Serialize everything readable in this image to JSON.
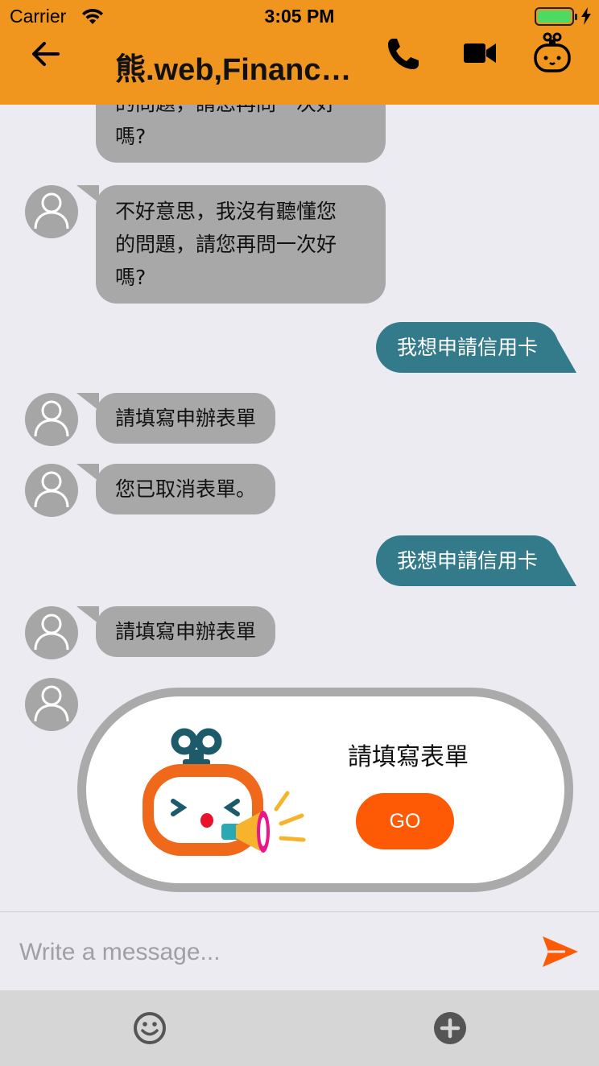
{
  "status_bar": {
    "carrier": "Carrier",
    "time": "3:05 PM"
  },
  "header": {
    "title": "熊.web,Finance...",
    "icons": [
      "back-arrow-icon",
      "phone-icon",
      "video-camera-icon",
      "robot-icon"
    ]
  },
  "messages": [
    {
      "from": "bot",
      "text": "的問題，請您再問一次好嗎?"
    },
    {
      "from": "bot",
      "lines": [
        "不好意思，我沒有聽懂您",
        "的問題，請您再問一次好",
        "嗎?"
      ]
    },
    {
      "from": "user",
      "text": "我想申請信用卡"
    },
    {
      "from": "bot",
      "text": "請填寫申辦表單"
    },
    {
      "from": "bot",
      "text": "您已取消表單。"
    },
    {
      "from": "user",
      "text": "我想申請信用卡"
    },
    {
      "from": "bot",
      "text": "請填寫申辦表單"
    }
  ],
  "form_card": {
    "title": "請填寫表單",
    "button_label": "GO"
  },
  "composer": {
    "placeholder": "Write a message..."
  },
  "colors": {
    "header": "#f0961e",
    "user_bubble": "#337b8a",
    "bot_bubble": "#a8a8a8",
    "accent": "#fe5a06"
  }
}
